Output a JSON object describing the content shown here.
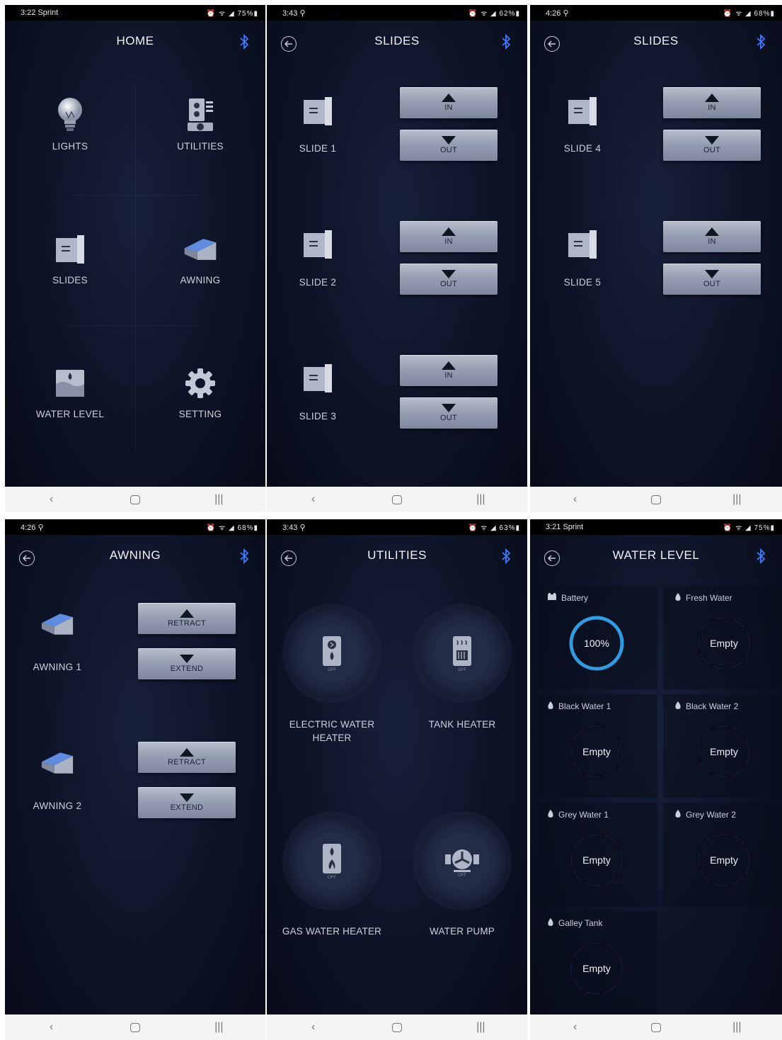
{
  "colors": {
    "bluetooth": "#3a7bff",
    "battery_ring": "#2f9be0",
    "empty_ring": "#0c101e",
    "button": "#949cb0"
  },
  "screens": {
    "home": {
      "status_time": "3:22 Sprint",
      "status_right": "⏰ ᯤ ◢ 75%▮",
      "title": "HOME",
      "items": [
        {
          "label": "LIGHTS",
          "icon": "lightbulb-icon"
        },
        {
          "label": "UTILITIES",
          "icon": "utilities-icon"
        },
        {
          "label": "SLIDES",
          "icon": "slide-icon"
        },
        {
          "label": "AWNING",
          "icon": "awning-icon"
        },
        {
          "label": "WATER LEVEL",
          "icon": "water-level-icon"
        },
        {
          "label": "SETTING",
          "icon": "gear-icon"
        }
      ]
    },
    "slides_a": {
      "status_time": "3:43 ⚲",
      "status_right": "⏰ ᯤ ◢ 62%▮",
      "title": "SLIDES",
      "rows": [
        {
          "label": "SLIDE 1"
        },
        {
          "label": "SLIDE 2"
        },
        {
          "label": "SLIDE 3"
        }
      ],
      "in_label": "IN",
      "out_label": "OUT"
    },
    "slides_b": {
      "status_time": "4:26 ⚲",
      "status_right": "⏰ ᯤ ◢ 68%▮",
      "title": "SLIDES",
      "rows": [
        {
          "label": "SLIDE 4"
        },
        {
          "label": "SLIDE 5"
        }
      ],
      "in_label": "IN",
      "out_label": "OUT"
    },
    "awning": {
      "status_time": "4:26 ⚲",
      "status_right": "⏰ ᯤ ◢ 68%▮",
      "title": "AWNING",
      "rows": [
        {
          "label": "AWNING 1"
        },
        {
          "label": "AWNING 2"
        }
      ],
      "retract_label": "RETRACT",
      "extend_label": "EXTEND"
    },
    "utilities": {
      "status_time": "3:43 ⚲",
      "status_right": "⏰ ᯤ ◢ 63%▮",
      "title": "UTILITIES",
      "off_label": "OFF",
      "items": [
        {
          "label": "ELECTRIC WATER HEATER"
        },
        {
          "label": "TANK HEATER"
        },
        {
          "label": "GAS WATER HEATER"
        },
        {
          "label": "WATER PUMP"
        }
      ]
    },
    "water_level": {
      "status_time": "3:21 Sprint",
      "status_right": "⏰ ᯤ ◢ 75%▮",
      "title": "WATER LEVEL",
      "tanks": [
        {
          "name": "Battery",
          "value": "100%",
          "level": 1.0
        },
        {
          "name": "Fresh Water",
          "value": "Empty",
          "level": 0
        },
        {
          "name": "Black Water 1",
          "value": "Empty",
          "level": 0
        },
        {
          "name": "Black Water 2",
          "value": "Empty",
          "level": 0
        },
        {
          "name": "Grey Water 1",
          "value": "Empty",
          "level": 0
        },
        {
          "name": "Grey Water 2",
          "value": "Empty",
          "level": 0
        },
        {
          "name": "Galley Tank",
          "value": "Empty",
          "level": 0
        }
      ]
    }
  }
}
